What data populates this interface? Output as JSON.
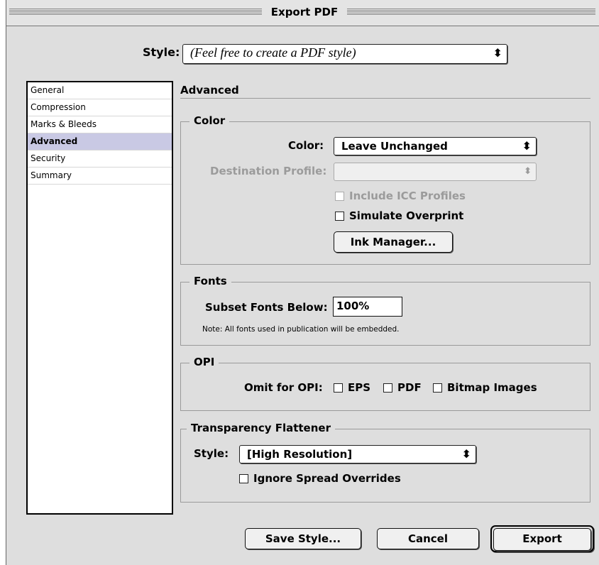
{
  "window": {
    "title": "Export PDF"
  },
  "style_row": {
    "label": "Style:",
    "value": "(Feel free to create a PDF style)",
    "arrow": "⬍"
  },
  "sidebar": {
    "items": [
      {
        "label": "General"
      },
      {
        "label": "Compression"
      },
      {
        "label": "Marks & Bleeds"
      },
      {
        "label": "Advanced"
      },
      {
        "label": "Security"
      },
      {
        "label": "Summary"
      }
    ]
  },
  "panel": {
    "title": "Advanced"
  },
  "color_group": {
    "title": "Color",
    "color_label": "Color:",
    "color_value": "Leave Unchanged",
    "dest_label": "Destination Profile:",
    "dest_value": "",
    "icc_label": "Include ICC Profiles",
    "simulate_label": "Simulate Overprint",
    "ink_manager_label": "Ink Manager..."
  },
  "fonts_group": {
    "title": "Fonts",
    "subset_label": "Subset Fonts Below:",
    "subset_value": "100%",
    "note": "Note: All fonts used in publication will be embedded."
  },
  "opi_group": {
    "title": "OPI",
    "omit_label": "Omit for OPI:",
    "eps_label": "EPS",
    "pdf_label": "PDF",
    "bitmap_label": "Bitmap Images"
  },
  "transparency_group": {
    "title": "Transparency Flattener",
    "style_label": "Style:",
    "style_value": "[High Resolution]",
    "ignore_label": "Ignore Spread Overrides"
  },
  "buttons": {
    "save_style": "Save Style...",
    "cancel": "Cancel",
    "export": "Export"
  },
  "colors": {
    "selection": "#c9c9e4",
    "window_bg": "#dedede"
  }
}
